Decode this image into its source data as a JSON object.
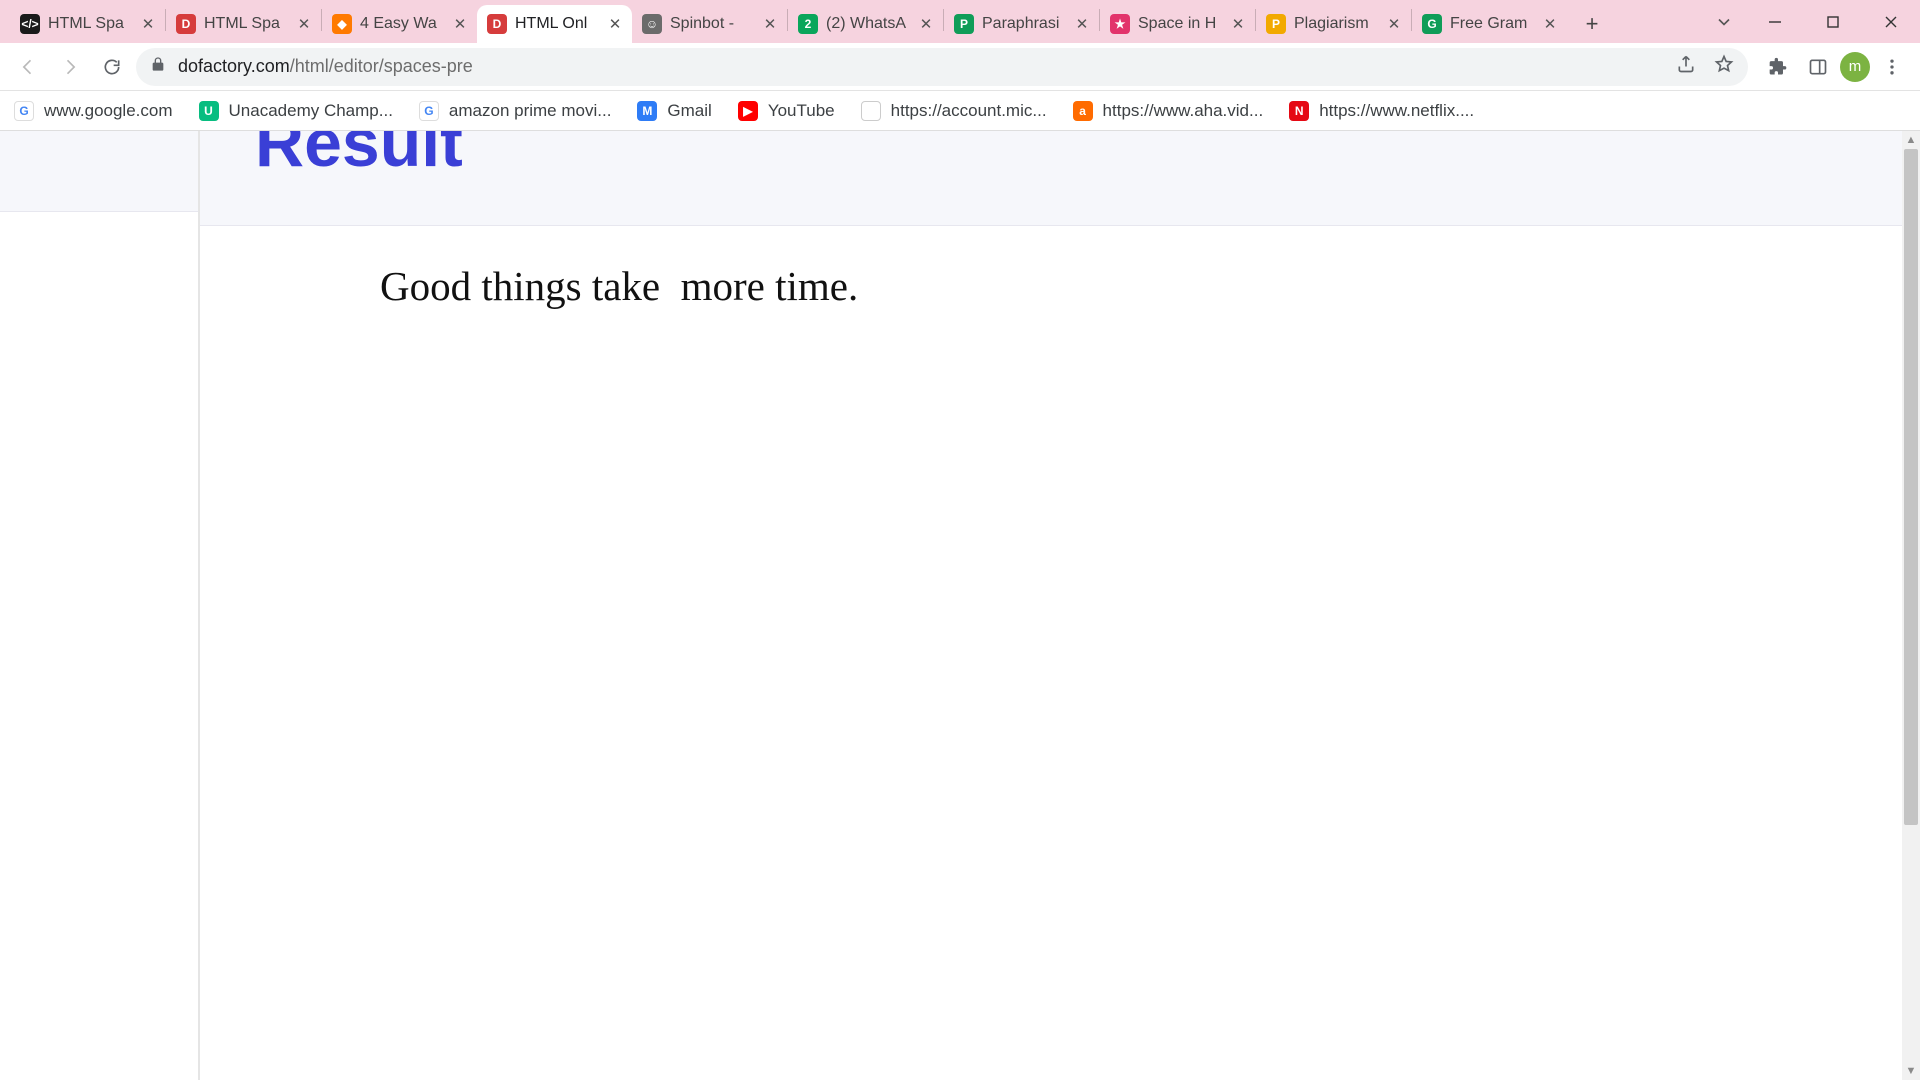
{
  "tabs": [
    {
      "label": "HTML Spa",
      "favColor": "fc-dark",
      "favText": "</>"
    },
    {
      "label": "HTML Spa",
      "favColor": "fc-red",
      "favText": "D"
    },
    {
      "label": "4 Easy Wa",
      "favColor": "fc-orange",
      "favText": "◆"
    },
    {
      "label": "HTML Onl",
      "favColor": "fc-red",
      "favText": "D",
      "active": true
    },
    {
      "label": "Spinbot - ",
      "favColor": "fc-robot",
      "favText": "☺"
    },
    {
      "label": "(2) WhatsA",
      "favColor": "fc-green",
      "favText": "2"
    },
    {
      "label": "Paraphrasi",
      "favColor": "fc-teal",
      "favText": "P"
    },
    {
      "label": "Space in H",
      "favColor": "fc-pink",
      "favText": "★"
    },
    {
      "label": "Plagiarism",
      "favColor": "fc-yellow",
      "favText": "P"
    },
    {
      "label": "Free Gram",
      "favColor": "fc-teal",
      "favText": "G"
    }
  ],
  "url": {
    "host": "dofactory.com",
    "path": "/html/editor/spaces-pre"
  },
  "avatar_letter": "m",
  "bookmarks": [
    {
      "label": "www.google.com",
      "favColor": "fc-goog",
      "favText": "G"
    },
    {
      "label": "Unacademy Champ...",
      "favColor": "fc-una",
      "favText": "U"
    },
    {
      "label": "amazon prime movi...",
      "favColor": "fc-goog",
      "favText": "G"
    },
    {
      "label": "Gmail",
      "favColor": "fc-blue",
      "favText": "M"
    },
    {
      "label": "YouTube",
      "favColor": "fc-ytred",
      "favText": "▶"
    },
    {
      "label": "https://account.mic...",
      "favColor": "fc-ms",
      "favText": "⊞"
    },
    {
      "label": "https://www.aha.vid...",
      "favColor": "fc-aha",
      "favText": "a"
    },
    {
      "label": "https://www.netflix....",
      "favColor": "fc-nflx",
      "favText": "N"
    }
  ],
  "page": {
    "result_title": "Result",
    "result_text": "Good things take  more time."
  }
}
